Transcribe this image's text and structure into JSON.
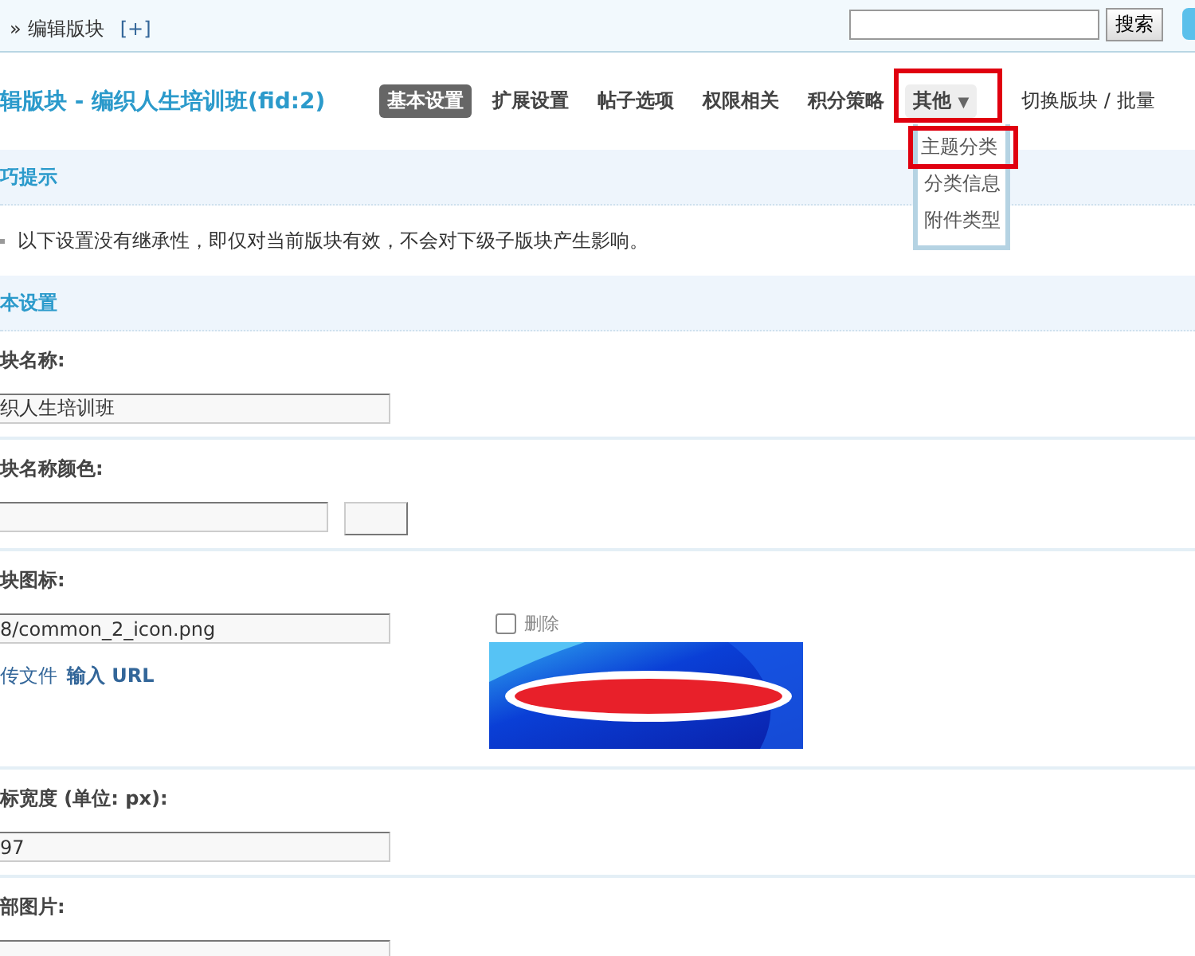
{
  "breadcrumb": {
    "prefix": "»",
    "text": "编辑版块",
    "add": "[+]"
  },
  "search": {
    "button": "搜索"
  },
  "title": "辑版块 - 编织人生培训班(fid:2)",
  "tabs": [
    {
      "label": "基本设置",
      "kind": "tab",
      "selected": true
    },
    {
      "label": "扩展设置",
      "kind": "tab",
      "selected": false
    },
    {
      "label": "帖子选项",
      "kind": "tab",
      "selected": false
    },
    {
      "label": "权限相关",
      "kind": "tab",
      "selected": false
    },
    {
      "label": "积分策略",
      "kind": "tab",
      "selected": false
    },
    {
      "label": "其他",
      "caret": "▼",
      "kind": "dropdown",
      "selected": false,
      "expanded": true,
      "highlighted": true
    }
  ],
  "links": "切换版块 / 批量",
  "dropdown_menu": [
    {
      "label": "主题分类",
      "highlighted": true
    },
    {
      "label": "分类信息",
      "highlighted": false
    },
    {
      "label": "附件类型",
      "highlighted": false
    }
  ],
  "tips": {
    "title": "巧提示",
    "text": "以下设置没有继承性，即仅对当前版块有效，不会对下级子版块产生影响。"
  },
  "settings": {
    "title": "本设置",
    "fields": [
      {
        "label": "块名称:",
        "kind": "text",
        "value": "织人生培训班"
      },
      {
        "label": "块名称颜色:",
        "kind": "color"
      },
      {
        "label": "块图标:",
        "kind": "icon",
        "value": "8/common_2_icon.png",
        "upload_link": "传文件",
        "url_link": "输入 URL",
        "delete_label": "删除",
        "delete_checked": false
      },
      {
        "label": "标宽度 (单位: px):",
        "kind": "text",
        "value": "97"
      },
      {
        "label": "部图片:",
        "kind": "text"
      }
    ]
  }
}
